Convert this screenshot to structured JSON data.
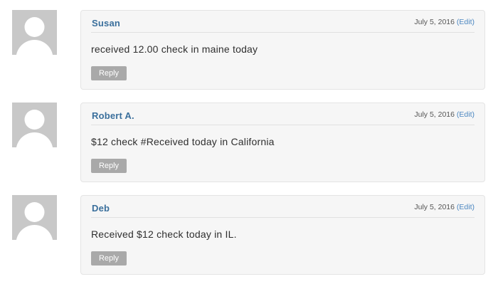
{
  "comments": [
    {
      "author": "Susan",
      "date": "July 5, 2016",
      "edit_label": "(Edit)",
      "text": "received 12.00 check in maine today",
      "reply_label": "Reply"
    },
    {
      "author": "Robert A.",
      "date": "July 5, 2016",
      "edit_label": "(Edit)",
      "text": "$12 check #Received today in California",
      "reply_label": "Reply"
    },
    {
      "author": "Deb",
      "date": "July 5, 2016",
      "edit_label": "(Edit)",
      "text": "Received $12 check today in IL.",
      "reply_label": "Reply"
    }
  ],
  "colors": {
    "author": "#3a6f9c",
    "edit_link": "#4a86c0",
    "box_background": "#f6f6f6",
    "reply_button": "#a9a9a9",
    "avatar_background": "#c8c8c8"
  },
  "icons": {
    "avatar": "default-avatar-icon"
  }
}
